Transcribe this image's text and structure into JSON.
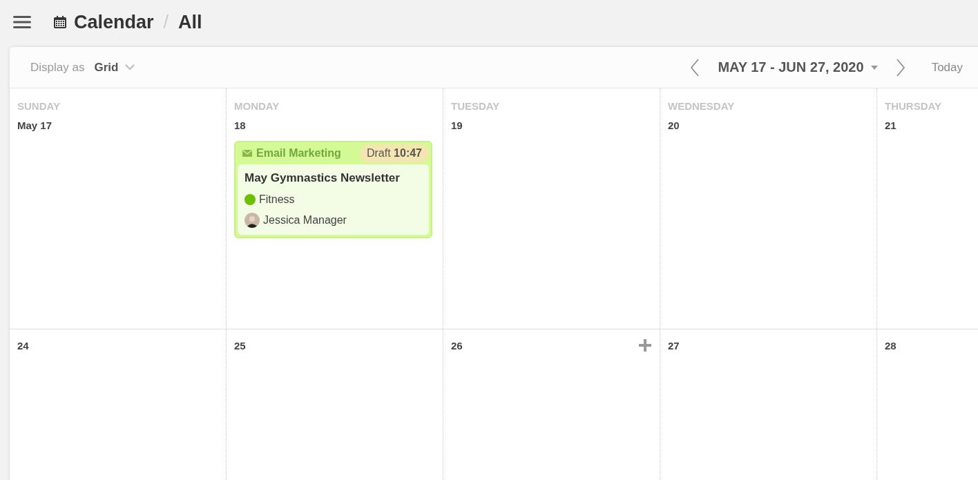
{
  "header": {
    "title": "Calendar",
    "separator": "/",
    "view": "All"
  },
  "toolbar": {
    "display_label": "Display as",
    "display_value": "Grid",
    "date_range": "MAY 17 - JUN 27, 2020",
    "today": "Today"
  },
  "weekdays": [
    "SUNDAY",
    "MONDAY",
    "TUESDAY",
    "WEDNESDAY",
    "THURSDAY"
  ],
  "weeks": [
    [
      {
        "date": "May 17"
      },
      {
        "date": "18",
        "events": [
          {
            "category": "Email Marketing",
            "status": "Draft",
            "time": "10:47",
            "title": "May Gymnastics Newsletter",
            "tag": {
              "label": "Fitness",
              "color": "#6cc000"
            },
            "assignee": "Jessica Manager"
          }
        ]
      },
      {
        "date": "19"
      },
      {
        "date": "20"
      },
      {
        "date": "21"
      }
    ],
    [
      {
        "date": "24"
      },
      {
        "date": "25"
      },
      {
        "date": "26",
        "show_add": true
      },
      {
        "date": "27"
      },
      {
        "date": "28"
      }
    ]
  ]
}
